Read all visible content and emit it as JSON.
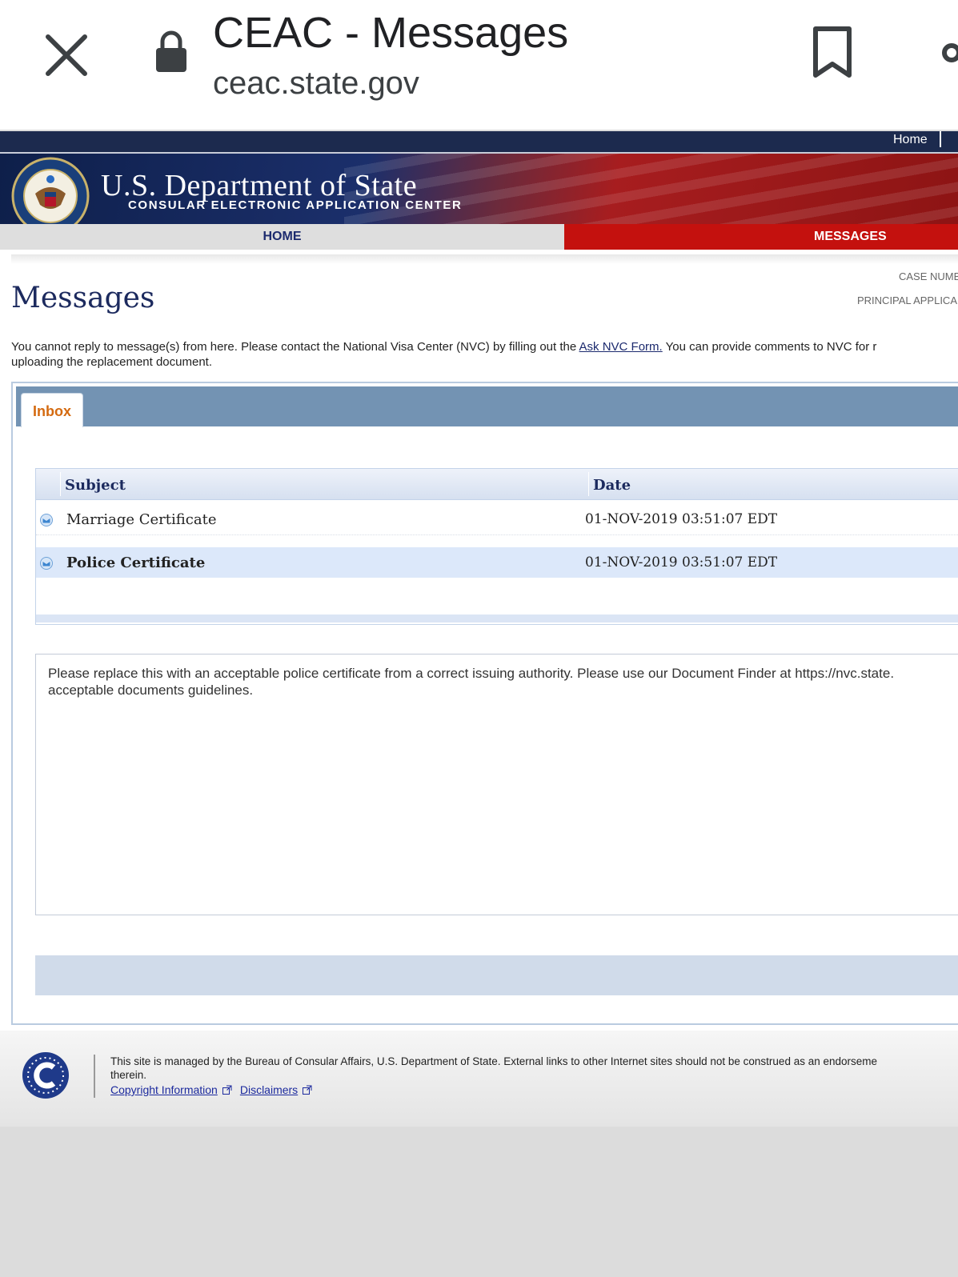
{
  "browser": {
    "tab_title": "CEAC - Messages",
    "url": "ceac.state.gov",
    "icons": [
      "close-icon",
      "lock-icon",
      "bookmark-icon",
      "more-icon"
    ]
  },
  "header": {
    "top_link_home": "Home",
    "department_name": "U.S. Department of State",
    "subtitle": "CONSULAR ELECTRONIC APPLICATION CENTER"
  },
  "nav": {
    "home": "HOME",
    "messages": "MESSAGES",
    "active_color": "#c4110e"
  },
  "page": {
    "title": "Messages",
    "case_number_label": "CASE NUMB",
    "principal_label": "PRINCIPAL APPLICA",
    "notice_part1": "You cannot reply to message(s) from here.  Please contact the National Visa Center (NVC) by filling out the ",
    "notice_link": "Ask NVC Form.",
    "notice_part2": "  You can provide comments to NVC for r",
    "notice_line2": "uploading the replacement document."
  },
  "inbox": {
    "tab_label": "Inbox",
    "columns": [
      "Subject",
      "Date"
    ],
    "rows": [
      {
        "subject": "Marriage Certificate",
        "date": "01-NOV-2019 03:51:07 EDT",
        "selected": false
      },
      {
        "subject": "Police Certificate",
        "date": "01-NOV-2019 03:51:07 EDT",
        "selected": true
      }
    ],
    "message_body": "Please replace this with an acceptable police certificate from a correct issuing authority. Please use our Document Finder at https://nvc.state.\nacceptable documents guidelines."
  },
  "footer": {
    "text": "This site is managed by the Bureau of Consular Affairs, U.S. Department of State. External links to other Internet sites should not be construed as an endorseme\ntherein.",
    "links": [
      "Copyright Information",
      "Disclaimers"
    ]
  }
}
